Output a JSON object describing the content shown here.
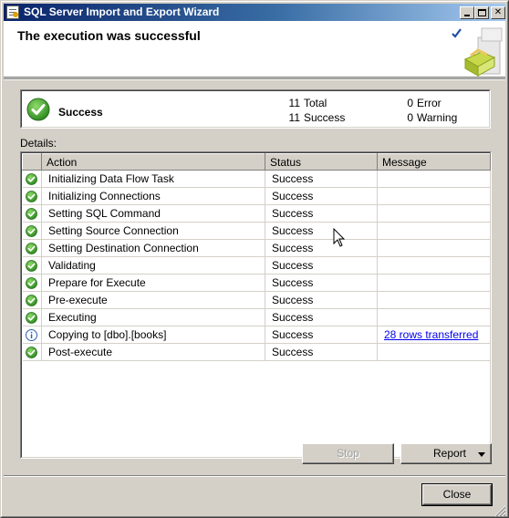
{
  "window": {
    "title": "SQL Server Import and Export Wizard"
  },
  "header": {
    "title": "The execution was successful"
  },
  "summary": {
    "status": "Success",
    "total_count": "11",
    "total_label": "Total",
    "success_count": "11",
    "success_label": "Success",
    "error_count": "0",
    "error_label": "Error",
    "warning_count": "0",
    "warning_label": "Warning"
  },
  "details": {
    "label": "Details:",
    "columns": [
      "",
      "Action",
      "Status",
      "Message"
    ],
    "rows": [
      {
        "icon": "success-check-icon",
        "action": "Initializing Data Flow Task",
        "status": "Success",
        "message": ""
      },
      {
        "icon": "success-check-icon",
        "action": "Initializing Connections",
        "status": "Success",
        "message": ""
      },
      {
        "icon": "success-check-icon",
        "action": "Setting SQL Command",
        "status": "Success",
        "message": ""
      },
      {
        "icon": "success-check-icon",
        "action": "Setting Source Connection",
        "status": "Success",
        "message": ""
      },
      {
        "icon": "success-check-icon",
        "action": "Setting Destination Connection",
        "status": "Success",
        "message": ""
      },
      {
        "icon": "success-check-icon",
        "action": "Validating",
        "status": "Success",
        "message": ""
      },
      {
        "icon": "success-check-icon",
        "action": "Prepare for Execute",
        "status": "Success",
        "message": ""
      },
      {
        "icon": "success-check-icon",
        "action": "Pre-execute",
        "status": "Success",
        "message": ""
      },
      {
        "icon": "success-check-icon",
        "action": "Executing",
        "status": "Success",
        "message": ""
      },
      {
        "icon": "info-icon",
        "action": "Copying to [dbo].[books]",
        "status": "Success",
        "message": "28 rows transferred"
      },
      {
        "icon": "success-check-icon",
        "action": "Post-execute",
        "status": "Success",
        "message": ""
      }
    ]
  },
  "buttons": {
    "stop": "Stop",
    "report": "Report",
    "close": "Close"
  },
  "colors": {
    "success_green": "#3c9a2e",
    "info_blue": "#2a5db0",
    "title_blue": "#0a246a"
  }
}
